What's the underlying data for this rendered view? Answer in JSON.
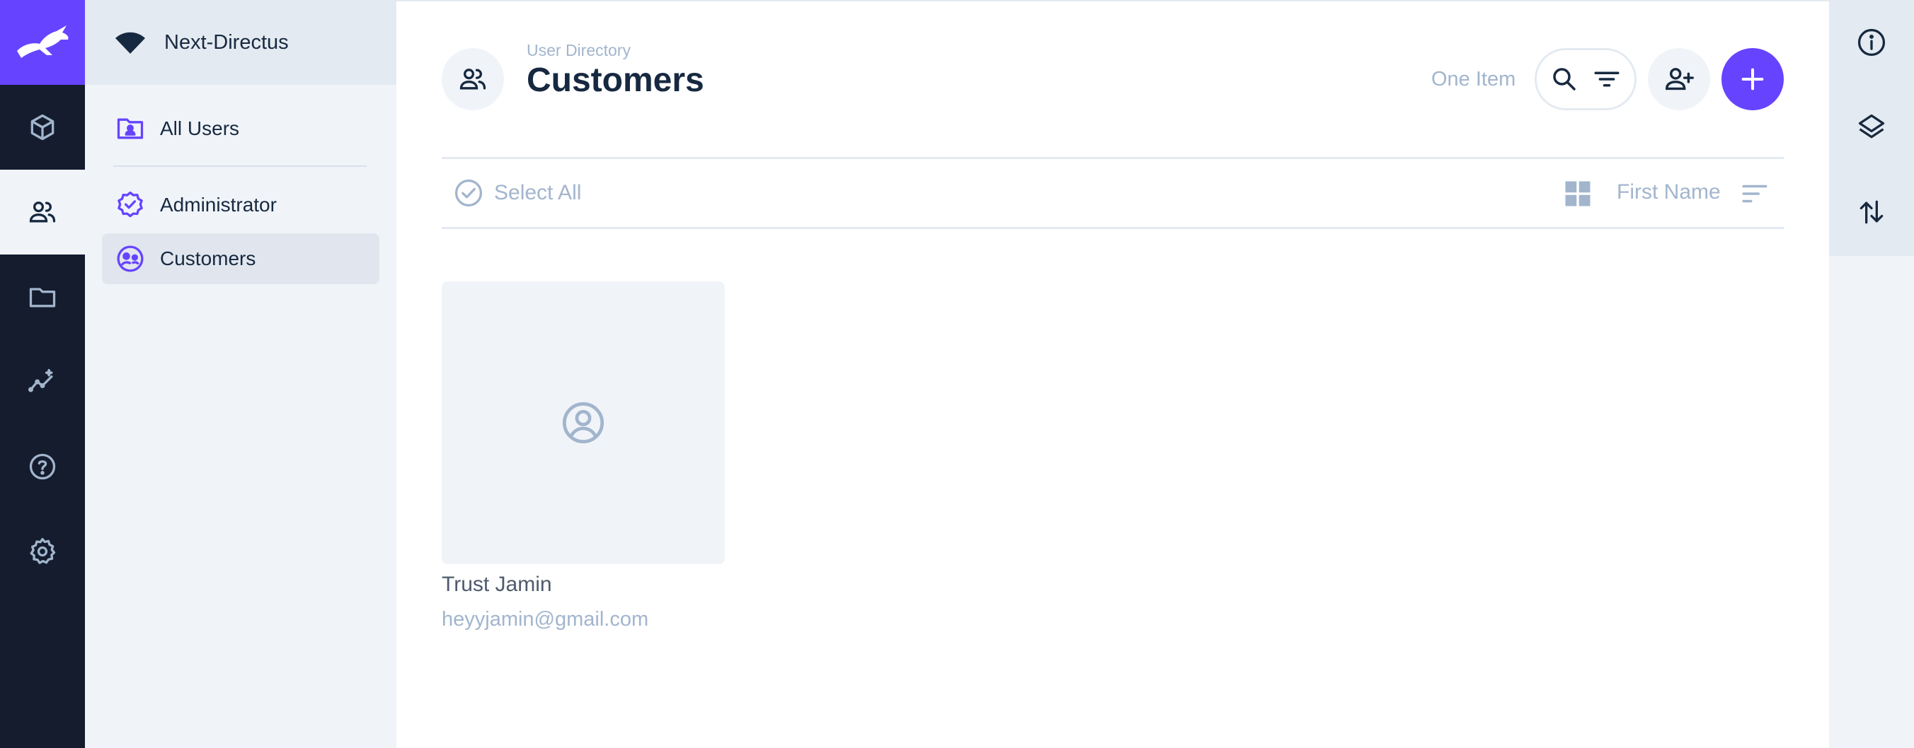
{
  "project": {
    "name": "Next-Directus"
  },
  "modules": [
    {
      "name": "content",
      "icon": "cube-icon"
    },
    {
      "name": "users",
      "icon": "people-icon",
      "active": true
    },
    {
      "name": "files",
      "icon": "folder-icon"
    },
    {
      "name": "insights",
      "icon": "insights-icon"
    },
    {
      "name": "help",
      "icon": "help-icon"
    },
    {
      "name": "settings",
      "icon": "gear-icon"
    }
  ],
  "navigation": {
    "all_users": "All Users",
    "roles": [
      {
        "label": "Administrator",
        "icon": "verified-badge-icon"
      },
      {
        "label": "Customers",
        "icon": "group-avatar-icon",
        "active": true
      }
    ]
  },
  "header": {
    "breadcrumb": "User Directory",
    "title": "Customers",
    "item_count": "One Item"
  },
  "toolbar": {
    "select_all": "Select All",
    "sort_field": "First Name"
  },
  "users": [
    {
      "name": "Trust Jamin",
      "email": "heyyjamin@gmail.com"
    }
  ],
  "colors": {
    "accent": "#6644ff",
    "module_bar": "#141c2e",
    "nav_bg": "#f0f4f9",
    "muted_text": "#a2b5cd",
    "text": "#172940"
  }
}
